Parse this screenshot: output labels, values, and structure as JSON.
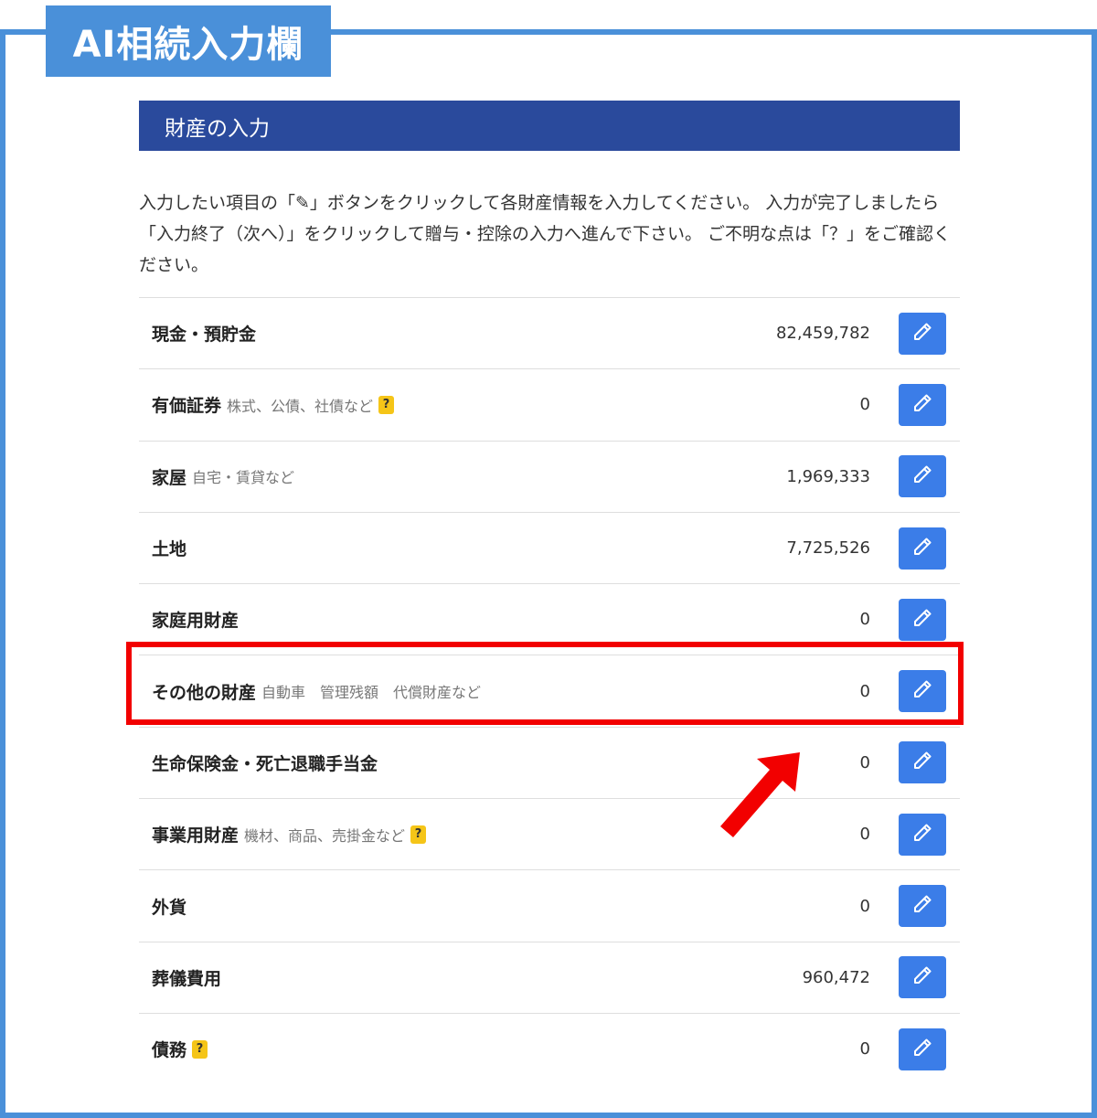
{
  "page_title": "AI相続入力欄",
  "section": {
    "header": "財産の入力",
    "instructions": "入力したい項目の「✎」ボタンをクリックして各財産情報を入力してください。 入力が完了しましたら「入力終了（次へ）」をクリックして贈与・控除の入力へ進んで下さい。 ご不明な点は「？」をご確認ください。"
  },
  "items": [
    {
      "label": "現金・預貯金",
      "sub": "",
      "help": "",
      "amount": "82,459,782"
    },
    {
      "label": "有価証券",
      "sub": "株式、公債、社債など",
      "help": "?",
      "amount": "0"
    },
    {
      "label": "家屋",
      "sub": "自宅・賃貸など",
      "help": "",
      "amount": "1,969,333"
    },
    {
      "label": "土地",
      "sub": "",
      "help": "",
      "amount": "7,725,526"
    },
    {
      "label": "家庭用財産",
      "sub": "",
      "help": "",
      "amount": "0"
    },
    {
      "label": "その他の財産",
      "sub": "自動車　管理残額　代償財産など",
      "help": "",
      "amount": "0"
    },
    {
      "label": "生命保険金・死亡退職手当金",
      "sub": "",
      "help": "",
      "amount": "0"
    },
    {
      "label": "事業用財産",
      "sub": "機材、商品、売掛金など",
      "help": "?",
      "amount": "0"
    },
    {
      "label": "外貨",
      "sub": "",
      "help": "",
      "amount": "0"
    },
    {
      "label": "葬儀費用",
      "sub": "",
      "help": "",
      "amount": "960,472"
    },
    {
      "label": "債務",
      "sub": "",
      "help": "?",
      "amount": "0"
    }
  ],
  "colors": {
    "frame": "#4a90d9",
    "header": "#2a4a9c",
    "edit_button": "#3b7de8",
    "help_badge": "#f5c518",
    "highlight": "#f20000"
  },
  "icons": {
    "edit": "pencil-icon",
    "callout": "arrow-icon"
  }
}
